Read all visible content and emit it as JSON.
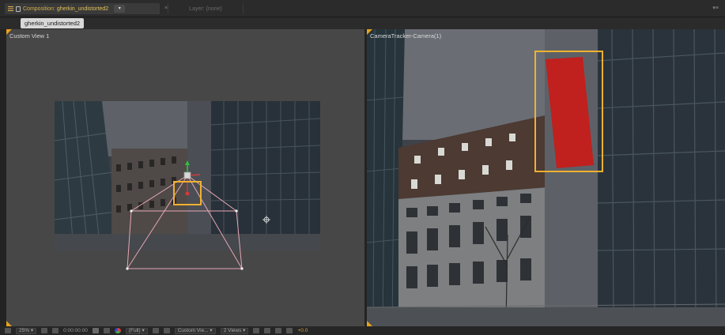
{
  "tabs": {
    "composition_label": "Composition:",
    "composition_name": "gherkin_undistorted2",
    "layer_tab": "Layer: (none)"
  },
  "breadcrumb": "gherkin_undistorted2",
  "left_view": {
    "label": "Custom View 1"
  },
  "right_view": {
    "label": "CameraTracker-Camera(1)"
  },
  "toolbar": {
    "zoom": "25%",
    "timecode": "0:00:00:00",
    "resolution": "(Full)",
    "view_select": "Custom Vie...",
    "view_layout": "2 Views",
    "exposure": "+0.0"
  },
  "colors": {
    "accent": "#e8a21c",
    "solid_red": "#c0201e",
    "highlight": "#f0b030",
    "camera_wire": "#e6a6b4"
  }
}
